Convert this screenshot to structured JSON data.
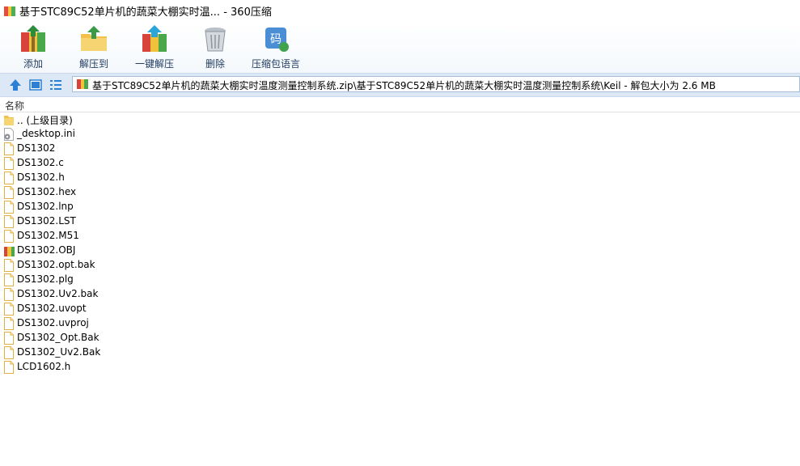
{
  "window": {
    "title": "基于STC89C52单片机的蔬菜大棚实时温... - 360压缩"
  },
  "toolbar": {
    "add_label": "添加",
    "extract_to_label": "解压到",
    "one_click_extract_label": "一键解压",
    "delete_label": "删除",
    "compress_lang_label": "压缩包语言",
    "lang_badge": "码"
  },
  "address": {
    "path": "基于STC89C52单片机的蔬菜大棚实时温度测量控制系统.zip\\基于STC89C52单片机的蔬菜大棚实时温度测量控制系统\\Keil - 解包大小为 2.6 MB"
  },
  "list": {
    "column_name": "名称",
    "items": [
      {
        "name": ".. (上级目录)",
        "icon": "folder-icon"
      },
      {
        "name": "_desktop.ini",
        "icon": "settings-file-icon"
      },
      {
        "name": "DS1302",
        "icon": "file-icon"
      },
      {
        "name": "DS1302.c",
        "icon": "file-icon"
      },
      {
        "name": "DS1302.h",
        "icon": "file-icon"
      },
      {
        "name": "DS1302.hex",
        "icon": "file-icon"
      },
      {
        "name": "DS1302.lnp",
        "icon": "file-icon"
      },
      {
        "name": "DS1302.LST",
        "icon": "file-icon"
      },
      {
        "name": "DS1302.M51",
        "icon": "file-icon"
      },
      {
        "name": "DS1302.OBJ",
        "icon": "archive-icon"
      },
      {
        "name": "DS1302.opt.bak",
        "icon": "file-icon"
      },
      {
        "name": "DS1302.plg",
        "icon": "file-icon"
      },
      {
        "name": "DS1302.Uv2.bak",
        "icon": "file-icon"
      },
      {
        "name": "DS1302.uvopt",
        "icon": "file-icon"
      },
      {
        "name": "DS1302.uvproj",
        "icon": "file-icon"
      },
      {
        "name": "DS1302_Opt.Bak",
        "icon": "file-icon"
      },
      {
        "name": "DS1302_Uv2.Bak",
        "icon": "file-icon"
      },
      {
        "name": "LCD1602.h",
        "icon": "file-icon"
      }
    ]
  }
}
